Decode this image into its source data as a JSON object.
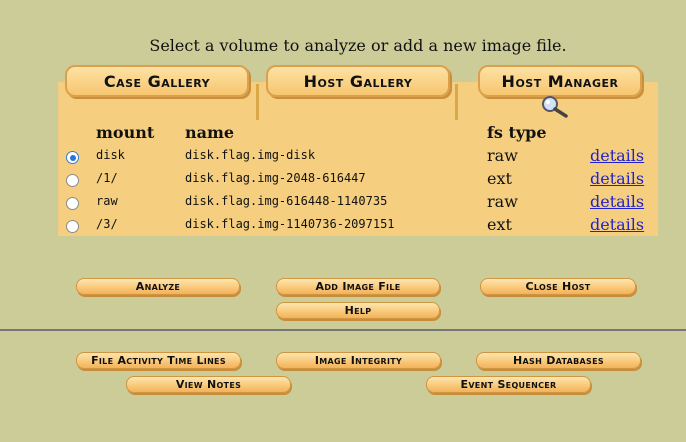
{
  "instruction": "Select a volume to analyze or add a new image file.",
  "tabs": [
    "Case Gallery",
    "Host Gallery",
    "Host Manager"
  ],
  "table": {
    "headers": {
      "mount": "mount",
      "name": "name",
      "fs_type": "fs type"
    },
    "rows": [
      {
        "selected": true,
        "mount": "disk",
        "name": "disk.flag.img-disk",
        "fs_type": "raw",
        "details": "details"
      },
      {
        "selected": false,
        "mount": "/1/",
        "name": "disk.flag.img-2048-616447",
        "fs_type": "ext",
        "details": "details"
      },
      {
        "selected": false,
        "mount": "raw",
        "name": "disk.flag.img-616448-1140735",
        "fs_type": "raw",
        "details": "details"
      },
      {
        "selected": false,
        "mount": "/3/",
        "name": "disk.flag.img-1140736-2097151",
        "fs_type": "ext",
        "details": "details"
      }
    ]
  },
  "buttons": {
    "analyze": "Analyze",
    "add_image_file": "Add Image File",
    "close_host": "Close Host",
    "help": "Help",
    "file_activity": "File Activity Time Lines",
    "image_integrity": "Image Integrity",
    "hash_databases": "Hash Databases",
    "view_notes": "View Notes",
    "event_sequencer": "Event Sequencer"
  },
  "icons": {
    "magnifier": "magnifier-icon"
  },
  "colors": {
    "background": "#cccc99",
    "panel": "#f5cf7f",
    "link": "#2222cc",
    "button": "#f9c97a"
  }
}
